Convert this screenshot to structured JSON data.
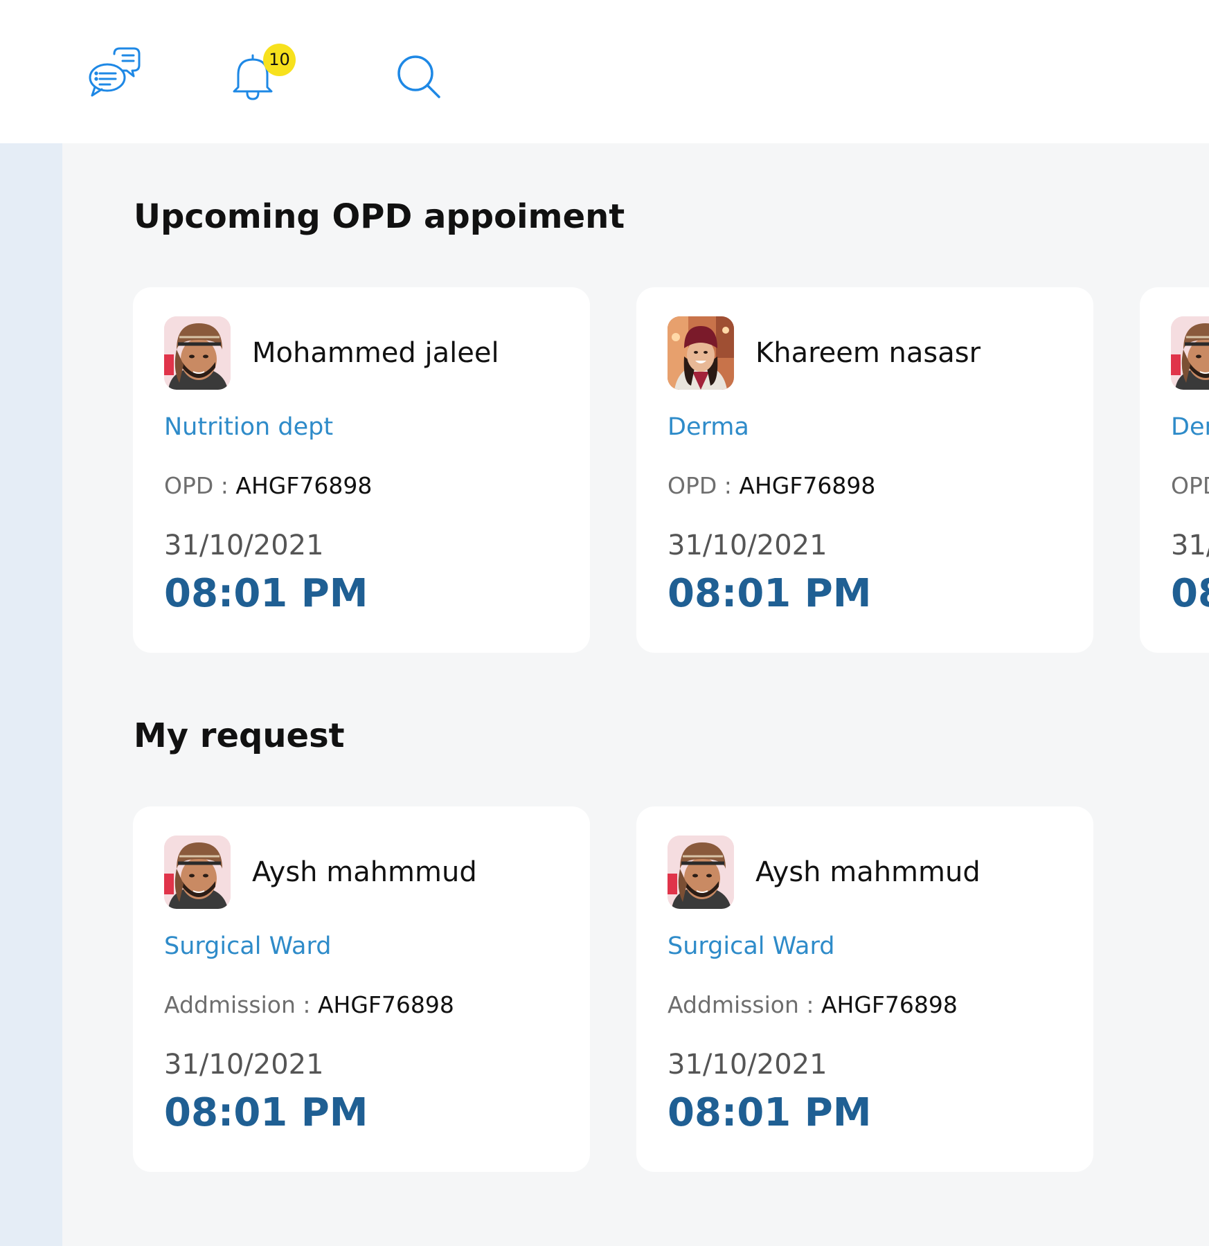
{
  "header": {
    "icons": [
      "chat-icon",
      "bell-icon",
      "search-icon"
    ],
    "notification_count": "10",
    "icon_color": "#1E88E5",
    "badge_color": "#F7E11D"
  },
  "upcoming": {
    "title": "Upcoming OPD appoiment",
    "cards": [
      {
        "name": "Mohammed jaleel",
        "dept": "Nutrition dept",
        "ref_label": "OPD : ",
        "ref_value": "AHGF76898",
        "date": "31/10/2021",
        "time": "08:01 PM"
      },
      {
        "name": "Khareem nasasr",
        "dept": "Derma",
        "ref_label": "OPD : ",
        "ref_value": "AHGF76898",
        "date": "31/10/2021",
        "time": "08:01 PM"
      },
      {
        "name": "",
        "dept": "Den",
        "ref_label": "OPD",
        "ref_value": "",
        "date": "31/",
        "time": "08"
      }
    ]
  },
  "requests": {
    "title": "My request",
    "cards": [
      {
        "name": "Aysh mahmmud",
        "dept": "Surgical Ward",
        "ref_label": "Addmission : ",
        "ref_value": "AHGF76898",
        "date": "31/10/2021",
        "time": "08:01 PM"
      },
      {
        "name": "Aysh mahmmud",
        "dept": "Surgical Ward",
        "ref_label": "Addmission : ",
        "ref_value": "AHGF76898",
        "date": "31/10/2021",
        "time": "08:01 PM"
      }
    ]
  },
  "colors": {
    "accent": "#2E8BC9",
    "time": "#1F5F93",
    "sidebar": "#E5EDF6",
    "content_bg": "#F5F6F7"
  }
}
